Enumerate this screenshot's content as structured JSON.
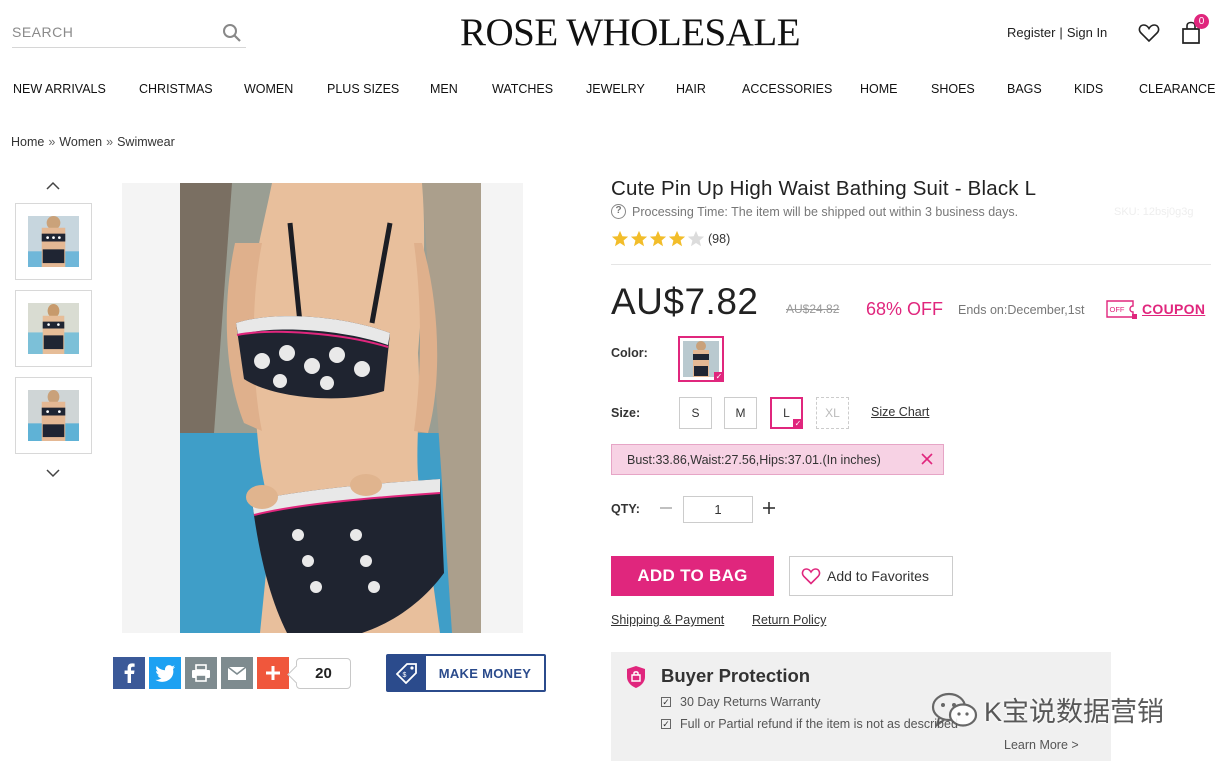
{
  "search": {
    "placeholder": "SEARCH",
    "icon": "search-icon"
  },
  "brand": {
    "name": "ROSE WHOLESALE",
    "accent_color": "#e0267d",
    "money_color": "#2b4b8c"
  },
  "account": {
    "register": "Register",
    "separator": "|",
    "sign_in": "Sign In",
    "cart_count": "0"
  },
  "nav": [
    "NEW ARRIVALS",
    "CHRISTMAS",
    "WOMEN",
    "PLUS SIZES",
    "MEN",
    "WATCHES",
    "JEWELRY",
    "HAIR",
    "ACCESSORIES",
    "HOME",
    "SHOES",
    "BAGS",
    "KIDS",
    "CLEARANCE"
  ],
  "breadcrumb": {
    "items": [
      "Home",
      "Women",
      "Swimwear"
    ],
    "separator": "»"
  },
  "gallery": {
    "thumbnail_count": 3
  },
  "share": {
    "icons": [
      "facebook-icon",
      "twitter-icon",
      "print-icon",
      "email-icon",
      "plus-icon"
    ],
    "count": "20",
    "make_money": "MAKE MONEY"
  },
  "product": {
    "title": "Cute Pin Up High Waist Bathing Suit - Black L",
    "processing": "Processing Time: The item will be shipped out within 3 business days.",
    "sku": "SKU: 12bsj0g3g",
    "rating": 4,
    "rating_max": 5,
    "reviews": "(98)",
    "price": "AU$7.82",
    "old_price": "AU$24.82",
    "discount": "68% OFF",
    "ends": "Ends on:December,1st",
    "coupon": "COUPON",
    "coupon_tag": "OFF"
  },
  "options": {
    "color_label": "Color:",
    "size_label": "Size:",
    "sizes": [
      "S",
      "M",
      "L",
      "XL"
    ],
    "selected_size": "L",
    "size_chart": "Size Chart",
    "measurements": "Bust:33.86,Waist:27.56,Hips:37.01.(In inches)"
  },
  "qty": {
    "label": "QTY:",
    "value": "1"
  },
  "actions": {
    "add_to_bag": "ADD TO BAG",
    "add_to_favorites": "Add to Favorites",
    "shipping": "Shipping & Payment",
    "return_policy": "Return Policy"
  },
  "buyer_protection": {
    "title": "Buyer Protection",
    "items": [
      "30 Day Returns Warranty",
      "Full or Partial refund if the item is not as described"
    ],
    "learn_more": "Learn More >"
  },
  "watermark": {
    "text": "K宝说数据营销"
  }
}
